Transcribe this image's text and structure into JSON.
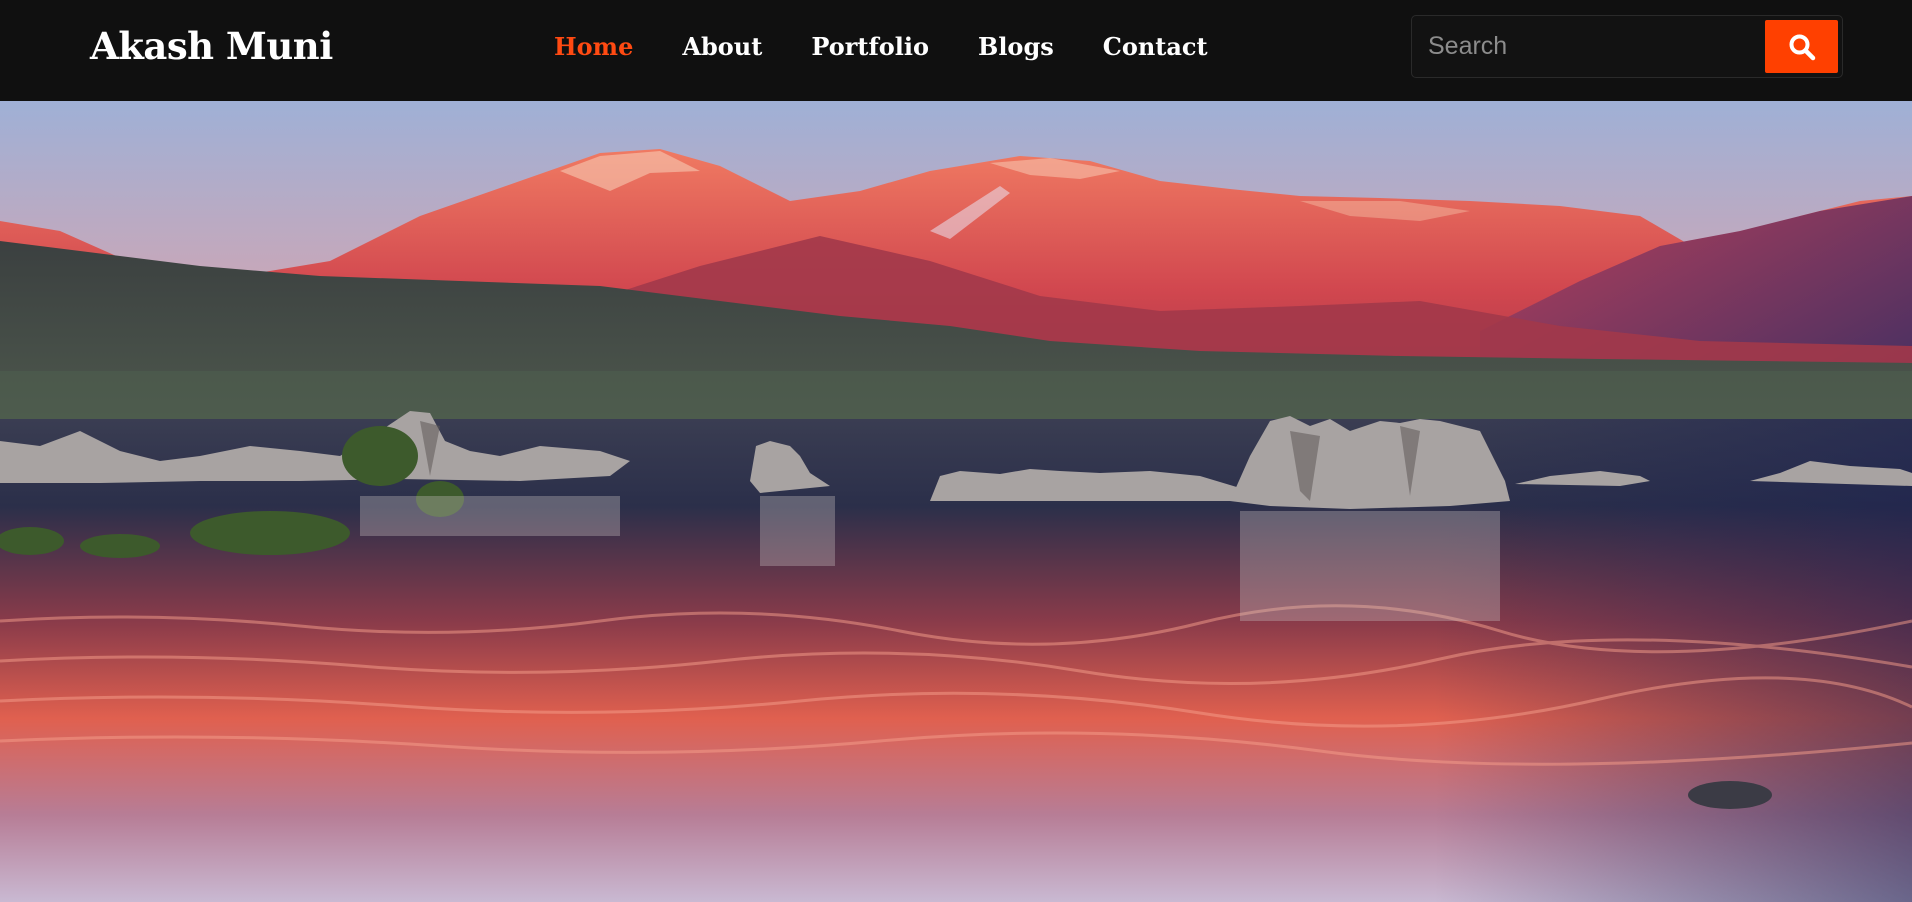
{
  "brand": {
    "name": "Akash Muni"
  },
  "nav": {
    "items": [
      {
        "label": "Home",
        "active": true
      },
      {
        "label": "About",
        "active": false
      },
      {
        "label": "Portfolio",
        "active": false
      },
      {
        "label": "Blogs",
        "active": false
      },
      {
        "label": "Contact",
        "active": false
      }
    ]
  },
  "search": {
    "placeholder": "Search",
    "value": "",
    "icon": "search-icon"
  },
  "colors": {
    "accent": "#ff4000",
    "nav_bg": "#101010",
    "text": "#ffffff"
  },
  "hero": {
    "image": "landscape-photo"
  }
}
